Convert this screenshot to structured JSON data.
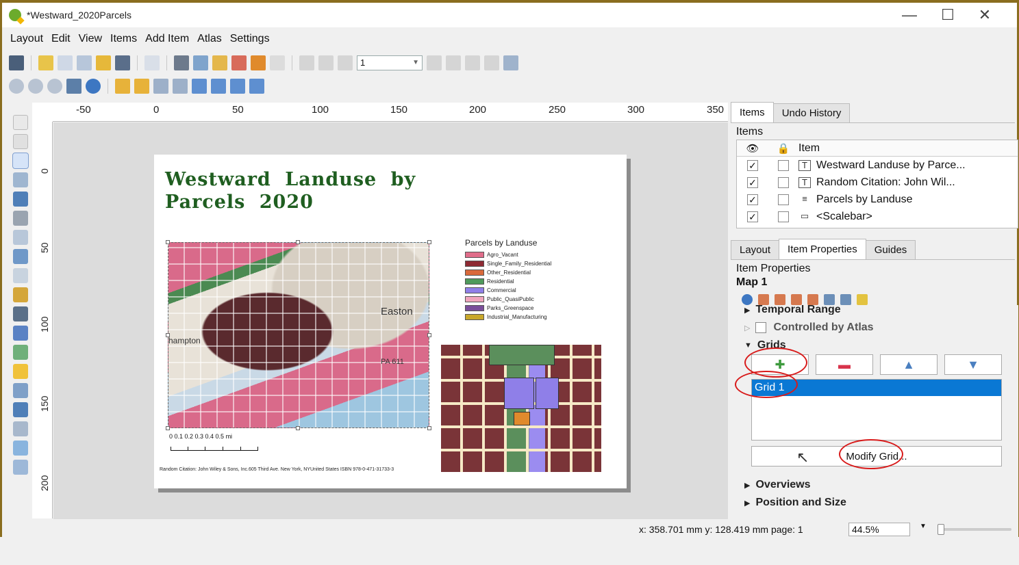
{
  "window": {
    "title": "*Westward_2020Parcels",
    "controls": [
      "—",
      "☐",
      "✕"
    ]
  },
  "menu": [
    "Layout",
    "Edit",
    "View",
    "Items",
    "Add Item",
    "Atlas",
    "Settings"
  ],
  "toolbar": {
    "page_value": "1"
  },
  "ruler": {
    "h_ticks": [
      "-50",
      "0",
      "50",
      "100",
      "150",
      "200",
      "250",
      "300",
      "350"
    ],
    "v_ticks": [
      "0",
      "50",
      "100",
      "150",
      "200"
    ]
  },
  "layout": {
    "title": "Westward Landuse by Parcels 2020",
    "map_labels": {
      "city": "Easton",
      "route": "PA 611",
      "town": "hampton"
    },
    "legend": {
      "title": "Parcels by Landuse",
      "items": [
        {
          "label": "Agro_Vacant",
          "color": "#e06d8a"
        },
        {
          "label": "Single_Family_Residential",
          "color": "#8e2a33"
        },
        {
          "label": "Other_Residential",
          "color": "#d9693b"
        },
        {
          "label": "Residential",
          "color": "#4e9a5c"
        },
        {
          "label": "Commercial",
          "color": "#8f7fe8"
        },
        {
          "label": "Public_QuasiPublic",
          "color": "#f0a5bd"
        },
        {
          "label": "Parks_Greenspace",
          "color": "#7a4e9a"
        },
        {
          "label": "Industrial_Manufacturing",
          "color": "#c8a72a"
        }
      ]
    },
    "scalebar": {
      "labels": "0   0.1  0.2  0.3  0.4  0.5 mi"
    },
    "citation": "Random Citation: John Wiley & Sons, Inc.605 Third Ave. New York, NYUnited States ISBN 978-0-471-31733-3"
  },
  "items_panel": {
    "tabs": [
      "Items",
      "Undo History"
    ],
    "heading": "Items",
    "column_item": "Item",
    "rows": [
      {
        "label": "Westward Landuse by Parce...",
        "icon": "T",
        "checked": "✓"
      },
      {
        "label": "Random Citation: John Wil...",
        "icon": "T",
        "checked": "✓"
      },
      {
        "label": "Parcels by Landuse",
        "icon": "≡",
        "checked": "✓"
      },
      {
        "label": "<Scalebar>",
        "icon": "▭",
        "checked": "✓"
      }
    ]
  },
  "props_panel": {
    "tabs": [
      "Layout",
      "Item Properties",
      "Guides"
    ],
    "heading": "Item Properties",
    "item_name": "Map 1",
    "sections": {
      "temporal": "Temporal Range",
      "atlas": "Controlled by Atlas",
      "grids": "Grids",
      "overviews": "Overviews",
      "position": "Position and Size"
    },
    "grid_list": [
      "Grid 1"
    ],
    "modify_button": "Modify Grid..."
  },
  "status": {
    "coords": "x: 358.701 mm y: 128.419 mm page: 1",
    "zoom": "44.5%"
  },
  "colors": {
    "accent_selection": "#0a78d4",
    "title_green": "#1f5e20",
    "annotation_red": "#d81a1a"
  }
}
